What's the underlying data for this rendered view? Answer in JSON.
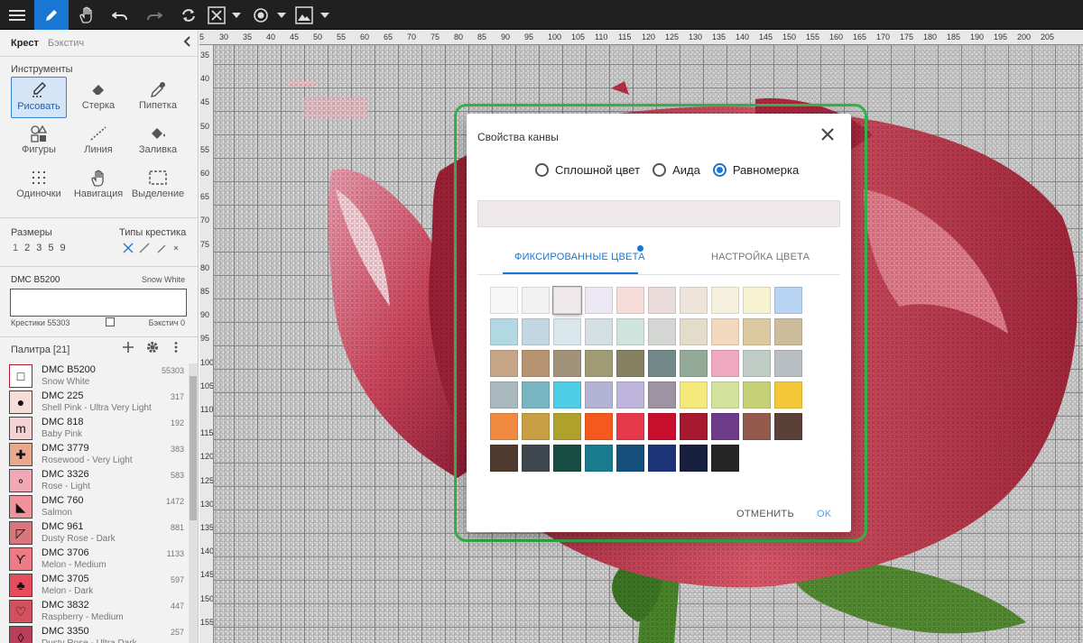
{
  "toolbar": {
    "icons": [
      "menu-icon",
      "pencil-icon",
      "hand-icon",
      "undo-icon",
      "redo-icon",
      "sync-icon",
      "x-box-icon",
      "chevron-down-icon",
      "eye-icon",
      "chevron-down-icon",
      "image-icon",
      "chevron-down-icon"
    ],
    "active": "pencil-icon"
  },
  "sidebar": {
    "mode_tabs": [
      "Крест",
      "Бэкстич"
    ],
    "tools_title": "Инструменты",
    "tools": [
      "Рисовать",
      "Стерка",
      "Пипетка",
      "Фигуры",
      "Линия",
      "Заливка",
      "Одиночки",
      "Навигация",
      "Выделение"
    ],
    "sizes_title": "Размеры",
    "sizes": [
      "1",
      "2",
      "3",
      "5",
      "9"
    ],
    "types_title": "Типы крестика",
    "current_code": "DMC B5200",
    "current_name": "Snow White",
    "crosses_label": "Крестики 55303",
    "backstitch_label": "Бэкстич 0",
    "palette_title": "Палитра [21]",
    "palette": [
      {
        "code": "DMC B5200",
        "name": "Snow White",
        "count": "55303",
        "color": "#ffffff",
        "symbol": "□"
      },
      {
        "code": "DMC 225",
        "name": "Shell Pink - Ultra Very Light",
        "count": "317",
        "color": "#f6ded6",
        "symbol": "●"
      },
      {
        "code": "DMC 818",
        "name": "Baby Pink",
        "count": "192",
        "color": "#f5d2d4",
        "symbol": "m"
      },
      {
        "code": "DMC 3779",
        "name": "Rosewood - Very Light",
        "count": "383",
        "color": "#e8a98e",
        "symbol": "✚"
      },
      {
        "code": "DMC 3326",
        "name": "Rose - Light",
        "count": "583",
        "color": "#f0a8b4",
        "symbol": "∘"
      },
      {
        "code": "DMC 760",
        "name": "Salmon",
        "count": "1472",
        "color": "#f0929a",
        "symbol": "◣"
      },
      {
        "code": "DMC 961",
        "name": "Dusty Rose - Dark",
        "count": "881",
        "color": "#d9767c",
        "symbol": "◸"
      },
      {
        "code": "DMC 3706",
        "name": "Melon - Medium",
        "count": "1133",
        "color": "#f07a84",
        "symbol": "ϒ"
      },
      {
        "code": "DMC 3705",
        "name": "Melon - Dark",
        "count": "597",
        "color": "#e84c5c",
        "symbol": "♣"
      },
      {
        "code": "DMC 3832",
        "name": "Raspberry - Medium",
        "count": "447",
        "color": "#d4505e",
        "symbol": "♡"
      },
      {
        "code": "DMC 3350",
        "name": "Dusty Rose - Ultra Dark",
        "count": "257",
        "color": "#bc3c5c",
        "symbol": "◊"
      }
    ]
  },
  "ruler_top": [
    "5",
    "30",
    "35",
    "40",
    "45",
    "50",
    "55",
    "60",
    "65",
    "70",
    "75",
    "80",
    "85",
    "90",
    "95",
    "100",
    "105",
    "110",
    "115",
    "120",
    "125",
    "130",
    "135",
    "140",
    "145",
    "150",
    "155",
    "160",
    "165",
    "170",
    "175",
    "180",
    "185",
    "190",
    "195",
    "200",
    "205"
  ],
  "ruler_left": [
    "35",
    "40",
    "45",
    "50",
    "55",
    "60",
    "65",
    "70",
    "75",
    "80",
    "85",
    "90",
    "95",
    "100",
    "105",
    "110",
    "115",
    "120",
    "125",
    "130",
    "135",
    "140",
    "145",
    "150",
    "155"
  ],
  "dialog": {
    "title": "Свойства канвы",
    "options": [
      "Сплошной цвет",
      "Аида",
      "Равномерка"
    ],
    "selected_option": "Равномерка",
    "preview_color": "#efe8ea",
    "tabs": [
      "ФИКСИРОВАННЫЕ ЦВЕТА",
      "НАСТРОЙКА ЦВЕТА"
    ],
    "active_tab": "ФИКСИРОВАННЫЕ ЦВЕТА",
    "swatches": [
      [
        "#f7f7f7",
        "#f2f2f2",
        "#f0e9eb",
        "#ebe8f3",
        "#f6dcd9",
        "#ebdcdc",
        "#eee4da",
        "#f6f1df",
        "#f6f2d2",
        "#b8d4f2"
      ],
      [
        "#b2d9e3",
        "#c2d7e2",
        "#d9e6ec",
        "#d3dfe2",
        "#cfe4dd",
        "#d4d6d3",
        "#e4dccb",
        "#f4d8bd",
        "#ddc9a0",
        "#cdbd9d"
      ],
      [
        "#c7a688",
        "#b69371",
        "#a29279",
        "#9f9b74",
        "#868163",
        "#738888",
        "#93aa98",
        "#efa9c0",
        "#bfccc6",
        "#b9bec3"
      ],
      [
        "#a8b8bd",
        "#78b5c0",
        "#4fcce6",
        "#b3b3d3",
        "#bcb4da",
        "#9e93a2",
        "#f6e97c",
        "#d3e29c",
        "#c5d176",
        "#f3c838"
      ],
      [
        "#f18a41",
        "#c89f43",
        "#aea22d",
        "#f45a1d",
        "#e7394c",
        "#c8102e",
        "#a6192e",
        "#6f3c8a",
        "#945a4e",
        "#5b4037"
      ],
      [
        "#4e3a2e",
        "#3d474d",
        "#184d43",
        "#1a7b8e",
        "#174f7c",
        "#1e3478",
        "#171f3e",
        "#252525"
      ]
    ],
    "selected_swatch": "#f0e9eb",
    "cancel_label": "ОТМЕНИТЬ",
    "ok_label": "OK"
  }
}
